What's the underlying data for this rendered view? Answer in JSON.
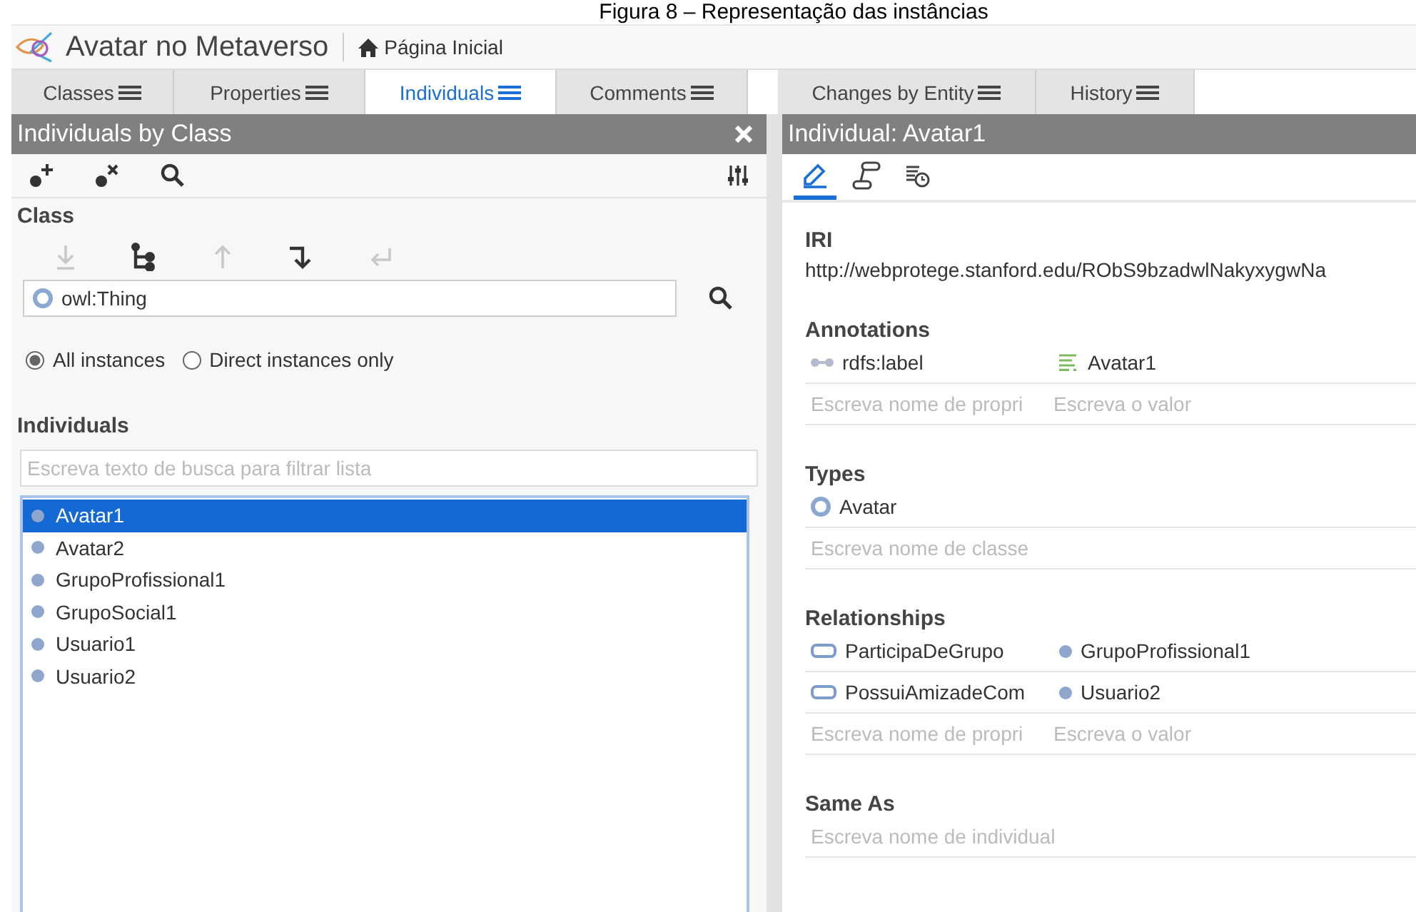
{
  "caption": "Figura 8 – Representação das instâncias",
  "app": {
    "title": "Avatar no Metaverso",
    "home_link": "Página Inicial"
  },
  "tabs": [
    {
      "label": "Classes",
      "selected": false
    },
    {
      "label": "Properties",
      "selected": false
    },
    {
      "label": "Individuals",
      "selected": true
    },
    {
      "label": "Comments",
      "selected": false
    },
    {
      "label": "Changes by Entity",
      "selected": false
    },
    {
      "label": "History",
      "selected": false
    }
  ],
  "left_panel": {
    "title": "Individuals by Class",
    "class_section": {
      "heading": "Class",
      "tools": [
        {
          "kind": "down",
          "disabled": true
        },
        {
          "kind": "tree",
          "disabled": false
        },
        {
          "kind": "up",
          "disabled": true
        },
        {
          "kind": "turn",
          "disabled": false
        },
        {
          "kind": "back",
          "disabled": true
        }
      ],
      "class_value": "owl:Thing",
      "radios": [
        {
          "label": "All instances",
          "selected": true
        },
        {
          "label": "Direct instances only",
          "selected": false
        }
      ]
    },
    "individuals": {
      "heading": "Individuals",
      "filter_placeholder": "Escreva texto de busca para filtrar lista",
      "items": [
        {
          "label": "Avatar1",
          "selected": true
        },
        {
          "label": "Avatar2",
          "selected": false
        },
        {
          "label": "GrupoProfissional1",
          "selected": false
        },
        {
          "label": "GrupoSocial1",
          "selected": false
        },
        {
          "label": "Usuario1",
          "selected": false
        },
        {
          "label": "Usuario2",
          "selected": false
        }
      ]
    }
  },
  "right_panel": {
    "title": "Individual: Avatar1",
    "view_tabs": [
      {
        "kind": "edit",
        "selected": true
      },
      {
        "kind": "graph",
        "selected": false
      },
      {
        "kind": "history",
        "selected": false
      }
    ],
    "iri": {
      "heading": "IRI",
      "value": "http://webprotege.stanford.edu/RObS9bzadwlNakyxygwNa"
    },
    "annotations": {
      "heading": "Annotations",
      "rows": [
        {
          "property": "rdfs:label",
          "value": "Avatar1"
        }
      ],
      "property_placeholder": "Escreva nome de propri",
      "value_placeholder": "Escreva o valor"
    },
    "types": {
      "heading": "Types",
      "items": [
        "Avatar"
      ],
      "placeholder": "Escreva nome de classe"
    },
    "relationships": {
      "heading": "Relationships",
      "rows": [
        {
          "property": "ParticipaDeGrupo",
          "value": "GrupoProfissional1"
        },
        {
          "property": "PossuiAmizadeCom",
          "value": "Usuario2"
        }
      ],
      "property_placeholder": "Escreva nome de propri",
      "value_placeholder": "Escreva o valor"
    },
    "same_as": {
      "heading": "Same As",
      "placeholder": "Escreva nome de individual"
    }
  }
}
